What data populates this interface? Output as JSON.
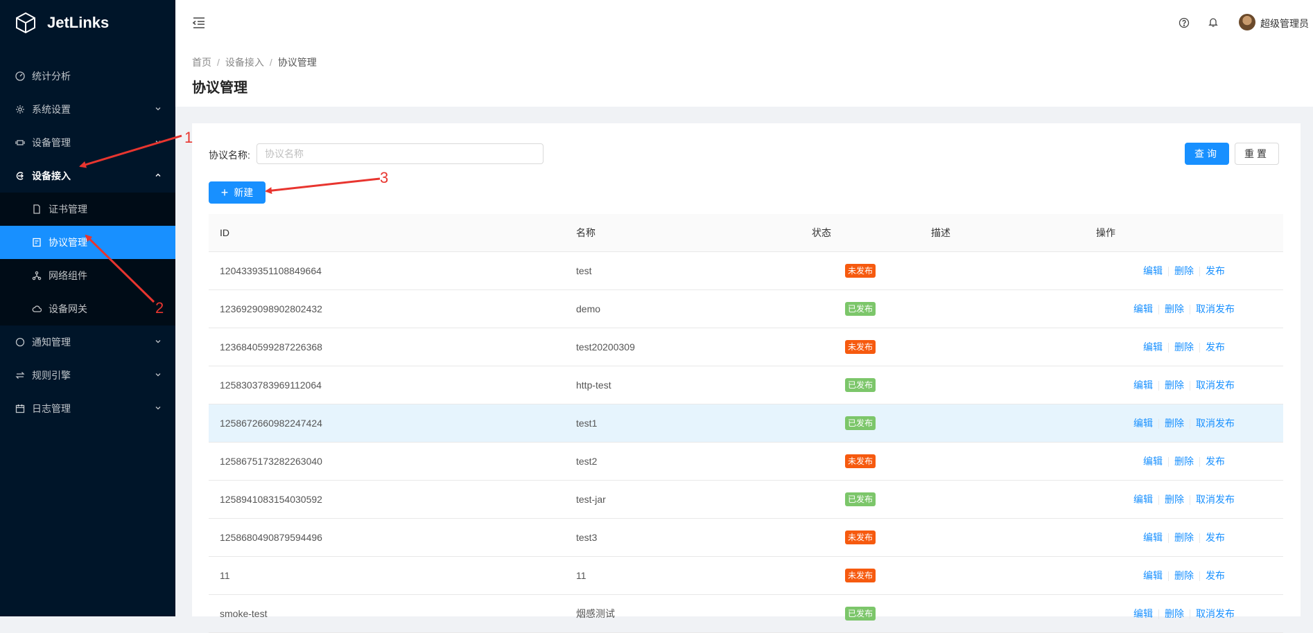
{
  "app": {
    "title": "JetLinks"
  },
  "sidebar": {
    "items": [
      {
        "label": "统计分析"
      },
      {
        "label": "系统设置"
      },
      {
        "label": "设备管理"
      },
      {
        "label": "设备接入"
      },
      {
        "label": "通知管理"
      },
      {
        "label": "规则引擎"
      },
      {
        "label": "日志管理"
      }
    ],
    "submenu": [
      {
        "label": "证书管理"
      },
      {
        "label": "协议管理"
      },
      {
        "label": "网络组件"
      },
      {
        "label": "设备网关"
      }
    ]
  },
  "header": {
    "user": "超级管理员"
  },
  "breadcrumb": {
    "home": "首页",
    "parent": "设备接入",
    "current": "协议管理"
  },
  "page": {
    "title": "协议管理"
  },
  "search": {
    "label": "协议名称:",
    "placeholder": "协议名称",
    "value": "",
    "query_label": "查询",
    "reset_label": "重置"
  },
  "toolbar": {
    "new_label": "新建"
  },
  "table": {
    "columns": {
      "id": "ID",
      "name": "名称",
      "status": "状态",
      "desc": "描述",
      "actions": "操作"
    },
    "rows": [
      {
        "id": "1204339351108849664",
        "name": "test",
        "status": "未发布",
        "actions": [
          "编辑",
          "删除",
          "发布"
        ]
      },
      {
        "id": "1236929098902802432",
        "name": "demo",
        "status": "已发布",
        "actions": [
          "编辑",
          "删除",
          "取消发布"
        ]
      },
      {
        "id": "1236840599287226368",
        "name": "test20200309",
        "status": "未发布",
        "actions": [
          "编辑",
          "删除",
          "发布"
        ]
      },
      {
        "id": "1258303783969112064",
        "name": "http-test",
        "status": "已发布",
        "actions": [
          "编辑",
          "删除",
          "取消发布"
        ]
      },
      {
        "id": "1258672660982247424",
        "name": "test1",
        "status": "已发布",
        "actions": [
          "编辑",
          "删除",
          "取消发布"
        ]
      },
      {
        "id": "1258675173282263040",
        "name": "test2",
        "status": "未发布",
        "actions": [
          "编辑",
          "删除",
          "发布"
        ]
      },
      {
        "id": "1258941083154030592",
        "name": "test-jar",
        "status": "已发布",
        "actions": [
          "编辑",
          "删除",
          "取消发布"
        ]
      },
      {
        "id": "1258680490879594496",
        "name": "test3",
        "status": "未发布",
        "actions": [
          "编辑",
          "删除",
          "发布"
        ]
      },
      {
        "id": "11",
        "name": "11",
        "status": "未发布",
        "actions": [
          "编辑",
          "删除",
          "发布"
        ]
      },
      {
        "id": "smoke-test",
        "name": "烟感测试",
        "status": "已发布",
        "actions": [
          "编辑",
          "删除",
          "取消发布"
        ]
      }
    ]
  },
  "annotations": {
    "one": "1",
    "two": "2",
    "three": "3"
  },
  "colors": {
    "primary": "#1890ff",
    "sidebar_bg": "#001529",
    "unpublished": "#f65a0f",
    "published": "#7cc66a",
    "annotation": "#e8352f"
  }
}
